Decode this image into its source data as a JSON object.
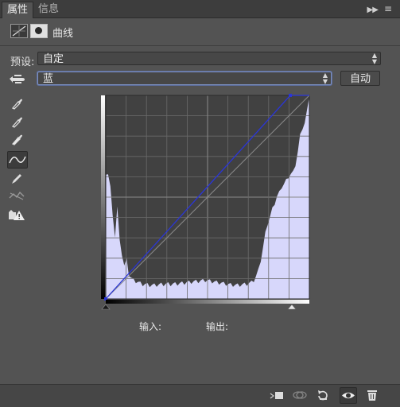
{
  "tabs": {
    "active": "属性",
    "second": "信息"
  },
  "panel": {
    "title": "曲线"
  },
  "preset": {
    "label": "预设:",
    "value": "自定"
  },
  "channel": {
    "value": "蓝"
  },
  "auto_button": "自动",
  "io": {
    "input_label": "输入:",
    "output_label": "输出:"
  },
  "colors": {
    "histogram": "#d7d7fb",
    "curve": "#2a35d8",
    "graph_bg": "#414141"
  },
  "histogram": [
    0.6,
    0.62,
    0.55,
    0.4,
    0.31,
    0.45,
    0.28,
    0.22,
    0.16,
    0.19,
    0.12,
    0.1,
    0.09,
    0.085,
    0.08,
    0.075,
    0.07,
    0.07,
    0.068,
    0.066,
    0.065,
    0.066,
    0.067,
    0.068,
    0.07,
    0.07,
    0.071,
    0.072,
    0.07,
    0.071,
    0.072,
    0.073,
    0.074,
    0.076,
    0.077,
    0.079,
    0.08,
    0.082,
    0.083,
    0.084,
    0.085,
    0.087,
    0.088,
    0.09,
    0.088,
    0.086,
    0.084,
    0.082,
    0.08,
    0.078,
    0.076,
    0.074,
    0.072,
    0.07,
    0.068,
    0.067,
    0.066,
    0.066,
    0.067,
    0.068,
    0.07,
    0.072,
    0.075,
    0.08,
    0.09,
    0.11,
    0.14,
    0.19,
    0.25,
    0.32,
    0.37,
    0.4,
    0.44,
    0.47,
    0.5,
    0.52,
    0.55,
    0.56,
    0.58,
    0.6,
    0.61,
    0.62,
    0.66,
    0.72,
    0.8,
    0.84,
    0.86,
    0.92,
    1.0
  ]
}
